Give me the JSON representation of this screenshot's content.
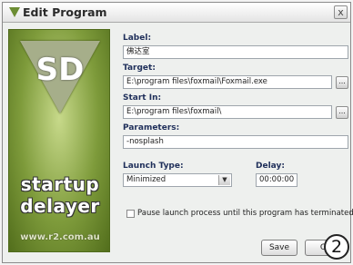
{
  "window": {
    "title": "Edit Program",
    "close_glyph": "x",
    "icon": "v-triangle-icon"
  },
  "banner": {
    "logo_text": "SD",
    "word1": "startup",
    "word2": "delayer",
    "url": "www.r2.com.au"
  },
  "form": {
    "label_label": "Label:",
    "label_value": "佛达室",
    "target_label": "Target:",
    "target_value": "E:\\program files\\foxmail\\Foxmail.exe",
    "start_in_label": "Start In:",
    "start_in_value": "E:\\program files\\foxmail\\",
    "parameters_label": "Parameters:",
    "parameters_value": "-nosplash",
    "launch_type_label": "Launch Type:",
    "launch_type_value": "Minimized",
    "delay_label": "Delay:",
    "delay_value": "00:00:00",
    "pause_label": "Pause launch process until this program has terminated",
    "pause_checked": false,
    "browse_glyph": "..."
  },
  "buttons": {
    "save": "Save",
    "cancel": "C"
  },
  "badge": "2"
}
